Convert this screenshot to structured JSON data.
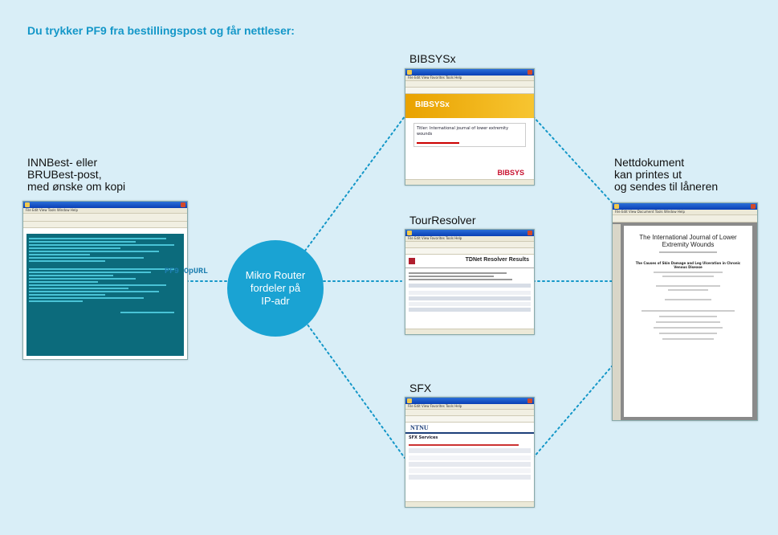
{
  "heading": "Du trykker PF9 fra bestillingspost og får nettleser:",
  "colors": {
    "background": "#d9eef7",
    "accent": "#1aa3d3",
    "heading": "#1497c8",
    "connector": "#1497c8"
  },
  "left_label": "INNBest- eller\nBRUBest-post,\nmed ønske om kopi",
  "right_label": "Nettdokument\nkan printes ut\nog sendes til låneren",
  "router_label": "Mikro Router\nfordeler på\nIP-adr",
  "pf9_label": "PF9 OpURL",
  "services": [
    {
      "label": "BIBSYSx",
      "banner": "BIBSYSx",
      "title": "Titler: International journal of lower extremity wounds",
      "footer": "BIBSYS"
    },
    {
      "label": "TourResolver",
      "banner": "TDNet Resolver Results"
    },
    {
      "label": "SFX",
      "banner": "NTNU",
      "subtitle": "SFX Services"
    }
  ],
  "document": {
    "title": "The International Journal of Lower Extremity Wounds",
    "article": "The Causes of Skin Damage and Leg Ulceration in Chronic Venous Disease"
  }
}
